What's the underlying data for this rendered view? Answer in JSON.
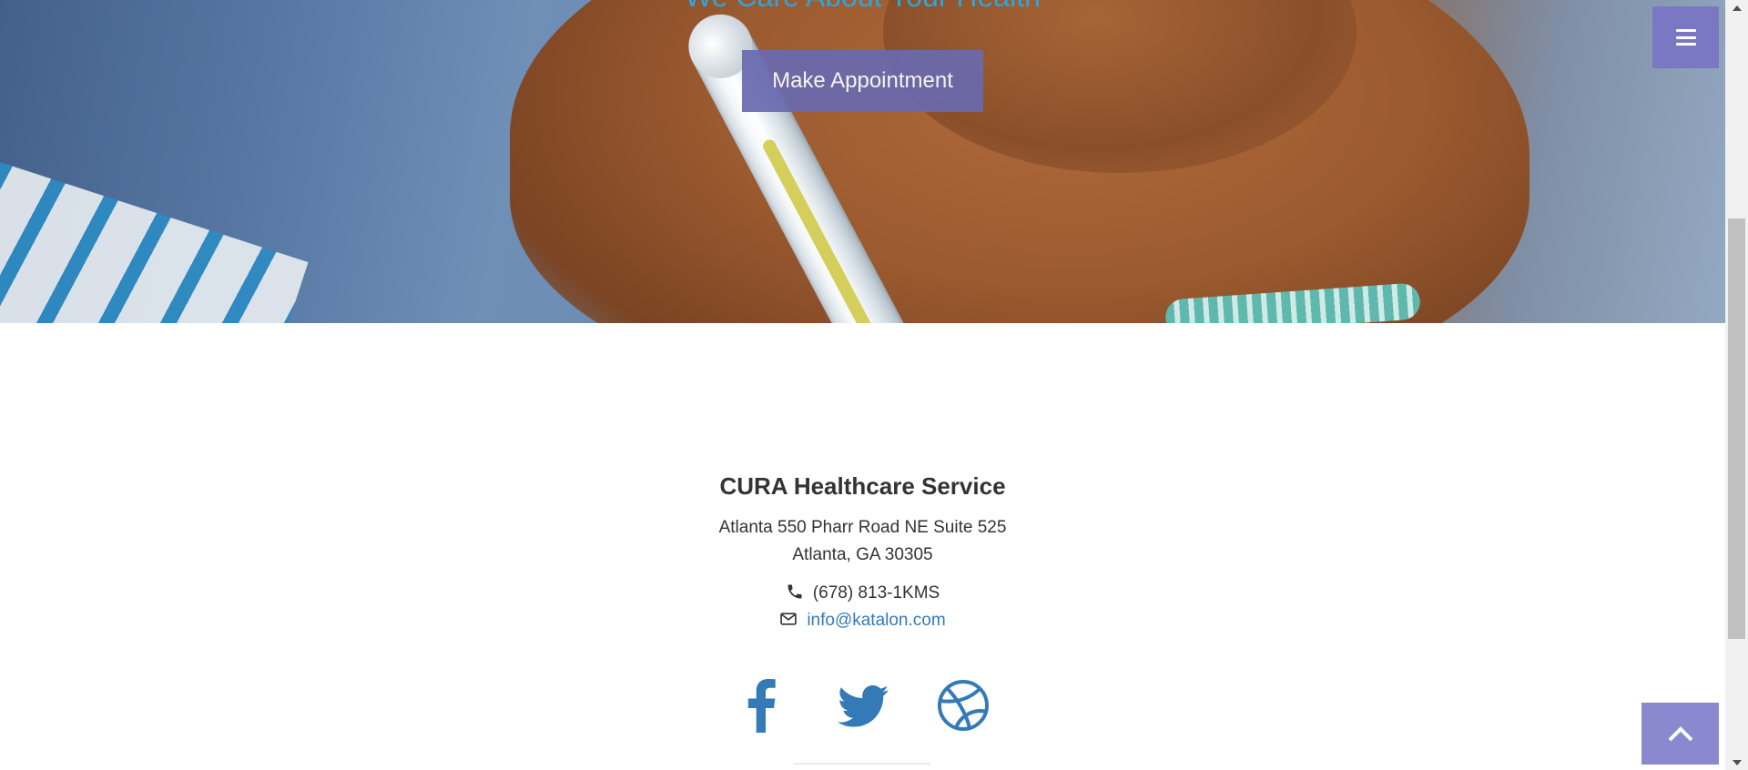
{
  "hero": {
    "tagline": "We Care About Your Health",
    "appointment_button": "Make Appointment"
  },
  "menu": {
    "icon": "menu-icon"
  },
  "footer": {
    "company": "CURA Healthcare Service",
    "address_line1": "Atlanta 550 Pharr Road NE Suite 525",
    "address_line2": "Atlanta, GA 30305",
    "phone": "(678) 813-1KMS",
    "email": "info@katalon.com",
    "social": [
      {
        "name": "facebook-icon"
      },
      {
        "name": "twitter-icon"
      },
      {
        "name": "dribbble-icon"
      }
    ]
  },
  "colors": {
    "accent": "#7a78c3",
    "link": "#337ab7",
    "tagline": "#2ea6dc",
    "text": "#333333"
  }
}
